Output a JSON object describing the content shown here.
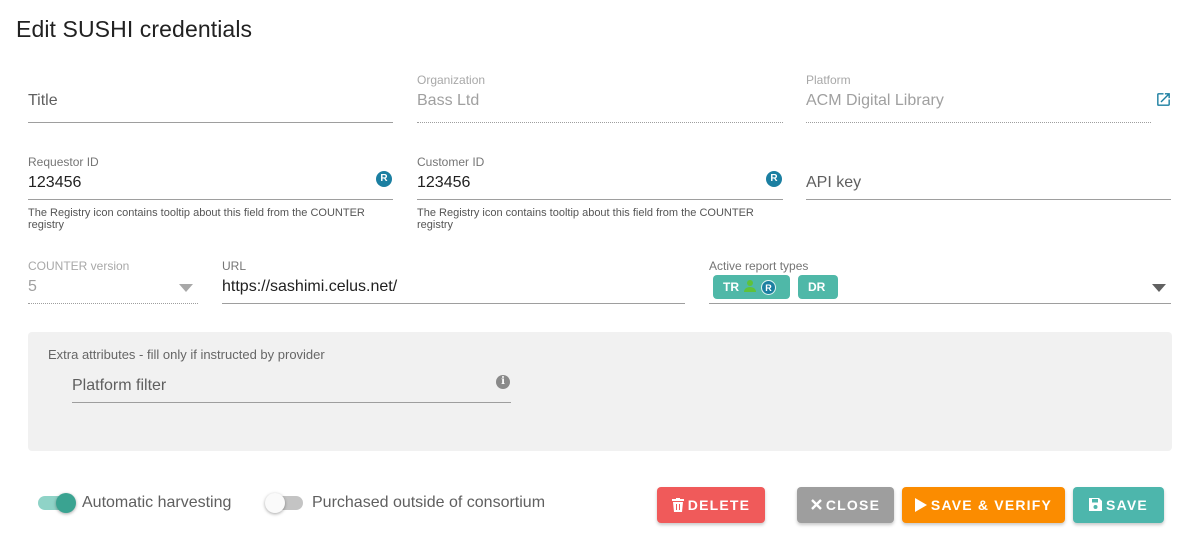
{
  "dialog": {
    "title": "Edit SUSHI credentials"
  },
  "fields": {
    "title": {
      "placeholder": "Title"
    },
    "organization": {
      "label": "Organization",
      "value": "Bass Ltd"
    },
    "platform": {
      "label": "Platform",
      "value": "ACM Digital Library",
      "icon": "open-in-new-icon"
    },
    "requestor_id": {
      "label": "Requestor ID",
      "value": "123456",
      "icon": "registry-icon",
      "icon_text": "R",
      "hint": "The Registry icon contains tooltip about this field from the COUNTER registry"
    },
    "customer_id": {
      "label": "Customer ID",
      "value": "123456",
      "icon": "registry-icon",
      "icon_text": "R",
      "hint": "The Registry icon contains tooltip about this field from the COUNTER registry"
    },
    "api_key": {
      "placeholder": "API key"
    },
    "counter_version": {
      "label": "COUNTER version",
      "value": "5"
    },
    "url": {
      "label": "URL",
      "value": "https://sashimi.celus.net/"
    },
    "report_types": {
      "label": "Active report types",
      "chips": [
        {
          "label": "TR",
          "icons": [
            "person-icon",
            "registry-icon"
          ],
          "icon_text": "R"
        },
        {
          "label": "DR"
        }
      ]
    }
  },
  "extra": {
    "header": "Extra attributes - fill only if instructed by provider",
    "platform_filter": {
      "placeholder": "Platform filter",
      "icon": "info-icon",
      "icon_text": "i"
    }
  },
  "switches": {
    "automatic_harvesting": {
      "label": "Automatic harvesting",
      "on": true
    },
    "purchased_outside": {
      "label": "Purchased outside of consortium",
      "on": false
    }
  },
  "buttons": {
    "delete": "DELETE",
    "close": "CLOSE",
    "save_verify": "SAVE & VERIFY",
    "save": "SAVE"
  },
  "colors": {
    "accent": "#4fb8a8",
    "registry": "#1b7fa1",
    "delete": "#f05a5a",
    "close": "#9e9e9e",
    "save_verify": "#fb8c00",
    "save": "#4db6ac"
  }
}
